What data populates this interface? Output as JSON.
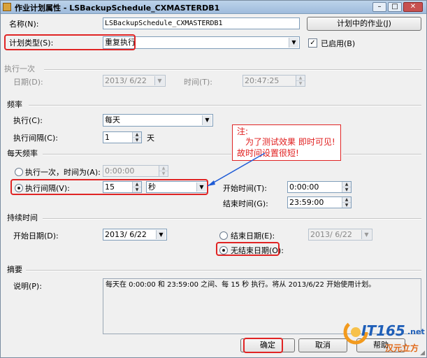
{
  "title": "作业计划属性 - LSBackupSchedule_CXMASTERDB1",
  "name_label": "名称(N):",
  "name_value": "LSBackupSchedule_CXMASTERDB1",
  "jobs_button": "计划中的作业(J)",
  "schedule_type_label": "计划类型(S):",
  "schedule_type_value": "重复执行",
  "enabled_label": "已启用(B)",
  "enabled_checked": true,
  "once_section": "执行一次",
  "once_date_label": "日期(D):",
  "once_date_value": "2013/ 6/22",
  "once_time_label": "时间(T):",
  "once_time_value": "20:47:25",
  "freq_section": "频率",
  "occurs_label": "执行(C):",
  "occurs_value": "每天",
  "recurs_label": "执行间隔(C):",
  "recurs_value": "1",
  "recurs_unit": "天",
  "daily_section": "每天频率",
  "once_at_label": "执行一次，时间为(A):",
  "once_at_value": "0:00:00",
  "every_label": "执行间隔(V):",
  "every_value": "15",
  "every_unit": "秒",
  "start_time_label": "开始时间(T):",
  "start_time_value": "0:00:00",
  "end_time_label": "结束时间(G):",
  "end_time_value": "23:59:00",
  "duration_section": "持续时间",
  "start_date_label": "开始日期(D):",
  "start_date_value": "2013/ 6/22",
  "end_date_label": "结束日期(E):",
  "end_date_value": "2013/ 6/22",
  "no_end_label": "无结束日期(O):",
  "summary_section": "摘要",
  "description_label": "说明(P):",
  "description_value": "每天在 0:00:00 和 23:59:00 之间、每 15 秒 执行。将从 2013/6/22 开始使用计划。",
  "note_title": "注:",
  "note_line1": "为了测试效果 即时可见!",
  "note_line2": "故时间设置很短!",
  "ok_button": "确定",
  "cancel_button": "取消",
  "help_button": "帮助",
  "watermark_brand": "IT165",
  "watermark_domain": ".net",
  "watermark_sub": "汉元立方",
  "colors": {
    "annotation_red": "#e02424",
    "title_bar": "#bcd3ea",
    "dialog_bg": "#f0f0f0"
  }
}
